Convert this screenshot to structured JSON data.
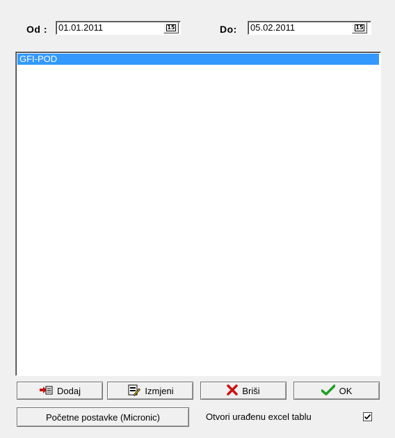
{
  "date_range": {
    "from_label": "Od :",
    "from_value": "01.01.2011",
    "to_label": "Do:",
    "to_value": "05.02.2011",
    "calendar_glyph": "15"
  },
  "list": {
    "items": [
      {
        "label": "GFI-POD",
        "selected": true
      }
    ]
  },
  "buttons": {
    "add_label": "Dodaj",
    "edit_label": "Izmjeni",
    "delete_label": "Briši",
    "ok_label": "OK",
    "defaults_label": "Početne postavke (Micronic)"
  },
  "checkbox": {
    "label": "Otvori urađenu excel tablu",
    "checked": true
  },
  "colors": {
    "selection": "#3399ff",
    "delete_icon": "#cc1111",
    "ok_icon": "#1f9e1f"
  }
}
